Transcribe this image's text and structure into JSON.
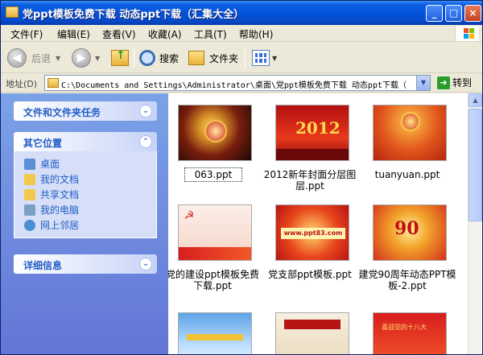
{
  "window": {
    "title": "党ppt模板免费下载 动态ppt下载（汇集大全）",
    "minimize": "_",
    "maximize": "□",
    "close": "×"
  },
  "menu": {
    "items": [
      "文件(F)",
      "编辑(E)",
      "查看(V)",
      "收藏(A)",
      "工具(T)",
      "帮助(H)"
    ]
  },
  "toolbar": {
    "back": "后退",
    "search": "搜索",
    "folders": "文件夹"
  },
  "address": {
    "label": "地址(D)",
    "value": "C:\\Documents and Settings\\Administrator\\桌面\\党ppt模板免费下载 动态ppt下载（",
    "go": "转到"
  },
  "sidebar": {
    "tasks_title": "文件和文件夹任务",
    "places_title": "其它位置",
    "places": [
      {
        "label": "桌面",
        "icon": "desktop-icon",
        "color": "#5a8fd8"
      },
      {
        "label": "我的文档",
        "icon": "my-documents-icon",
        "color": "#f2c94c"
      },
      {
        "label": "共享文档",
        "icon": "shared-documents-icon",
        "color": "#f2c94c"
      },
      {
        "label": "我的电脑",
        "icon": "my-computer-icon",
        "color": "#7aa0c8"
      },
      {
        "label": "网上邻居",
        "icon": "network-places-icon",
        "color": "#4a8fd1"
      }
    ],
    "details_title": "详细信息"
  },
  "files": [
    {
      "name": "063.ppt",
      "selected": true
    },
    {
      "name": "2012新年封面分层图层.ppt"
    },
    {
      "name": "tuanyuan.ppt"
    },
    {
      "name": "党的建设ppt模板免费下载.ppt"
    },
    {
      "name": "党支部ppt模板.ppt"
    },
    {
      "name": "建党90周年动态PPT模板-2.ppt"
    }
  ],
  "thumb_text": {
    "t2": "2012",
    "t5": "www.ppt83.com",
    "t6": "90",
    "t9": "喜迎党的十八大"
  },
  "colors": {
    "title_bar": "#0553dc",
    "sidebar_link": "#215dc6",
    "sidebar_bg": "#7ba2e7"
  }
}
